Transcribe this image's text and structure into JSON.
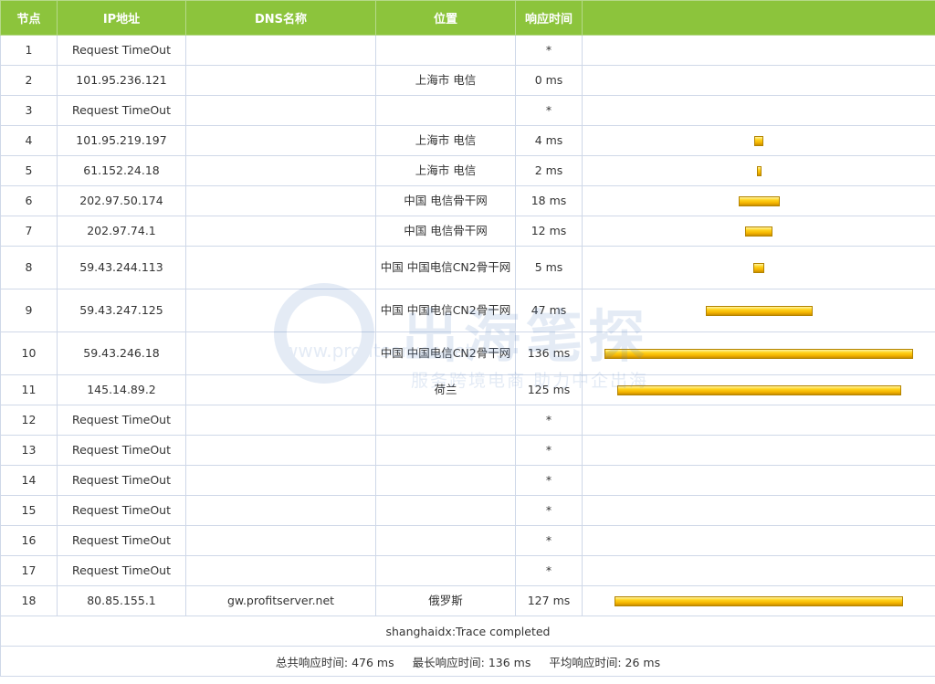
{
  "headers": {
    "hop": "节点",
    "ip": "IP地址",
    "dns": "DNS名称",
    "location": "位置",
    "response": "响应时间"
  },
  "rows": [
    {
      "hop": "1",
      "ip": "Request TimeOut",
      "dns": "",
      "location": "",
      "time": "*",
      "ms": 0
    },
    {
      "hop": "2",
      "ip": "101.95.236.121",
      "dns": "",
      "location": "上海市 电信",
      "time": "0 ms",
      "ms": 0
    },
    {
      "hop": "3",
      "ip": "Request TimeOut",
      "dns": "",
      "location": "",
      "time": "*",
      "ms": 0
    },
    {
      "hop": "4",
      "ip": "101.95.219.197",
      "dns": "",
      "location": "上海市 电信",
      "time": "4 ms",
      "ms": 4
    },
    {
      "hop": "5",
      "ip": "61.152.24.18",
      "dns": "",
      "location": "上海市 电信",
      "time": "2 ms",
      "ms": 2
    },
    {
      "hop": "6",
      "ip": "202.97.50.174",
      "dns": "",
      "location": "中国 电信骨干网",
      "time": "18 ms",
      "ms": 18
    },
    {
      "hop": "7",
      "ip": "202.97.74.1",
      "dns": "",
      "location": "中国 电信骨干网",
      "time": "12 ms",
      "ms": 12
    },
    {
      "hop": "8",
      "ip": "59.43.244.113",
      "dns": "",
      "location": "中国 中国电信CN2骨干网",
      "time": "5 ms",
      "ms": 5
    },
    {
      "hop": "9",
      "ip": "59.43.247.125",
      "dns": "",
      "location": "中国 中国电信CN2骨干网",
      "time": "47 ms",
      "ms": 47
    },
    {
      "hop": "10",
      "ip": "59.43.246.18",
      "dns": "",
      "location": "中国 中国电信CN2骨干网",
      "time": "136 ms",
      "ms": 136
    },
    {
      "hop": "11",
      "ip": "145.14.89.2",
      "dns": "",
      "location": "荷兰",
      "time": "125 ms",
      "ms": 125
    },
    {
      "hop": "12",
      "ip": "Request TimeOut",
      "dns": "",
      "location": "",
      "time": "*",
      "ms": 0
    },
    {
      "hop": "13",
      "ip": "Request TimeOut",
      "dns": "",
      "location": "",
      "time": "*",
      "ms": 0
    },
    {
      "hop": "14",
      "ip": "Request TimeOut",
      "dns": "",
      "location": "",
      "time": "*",
      "ms": 0
    },
    {
      "hop": "15",
      "ip": "Request TimeOut",
      "dns": "",
      "location": "",
      "time": "*",
      "ms": 0
    },
    {
      "hop": "16",
      "ip": "Request TimeOut",
      "dns": "",
      "location": "",
      "time": "*",
      "ms": 0
    },
    {
      "hop": "17",
      "ip": "Request TimeOut",
      "dns": "",
      "location": "",
      "time": "*",
      "ms": 0
    },
    {
      "hop": "18",
      "ip": "80.85.155.1",
      "dns": "gw.profitserver.net",
      "location": "俄罗斯",
      "time": "127 ms",
      "ms": 127
    }
  ],
  "status": "shanghaidx:Trace completed",
  "summary": {
    "total_label": "总共响应时间:",
    "total_value": "476 ms",
    "max_label": "最长响应时间:",
    "max_value": "136 ms",
    "avg_label": "平均响应时间:",
    "avg_value": "26 ms"
  },
  "watermark": {
    "logo_text": "出海笔探",
    "url": "www.profitserver.net",
    "slogan": "服务跨境电商 助力中企出海"
  },
  "colors": {
    "header_bg": "#8cc43c",
    "header_text": "#ffffff",
    "bar_fill": "#ffd21a",
    "border": "#cfd8e8"
  }
}
